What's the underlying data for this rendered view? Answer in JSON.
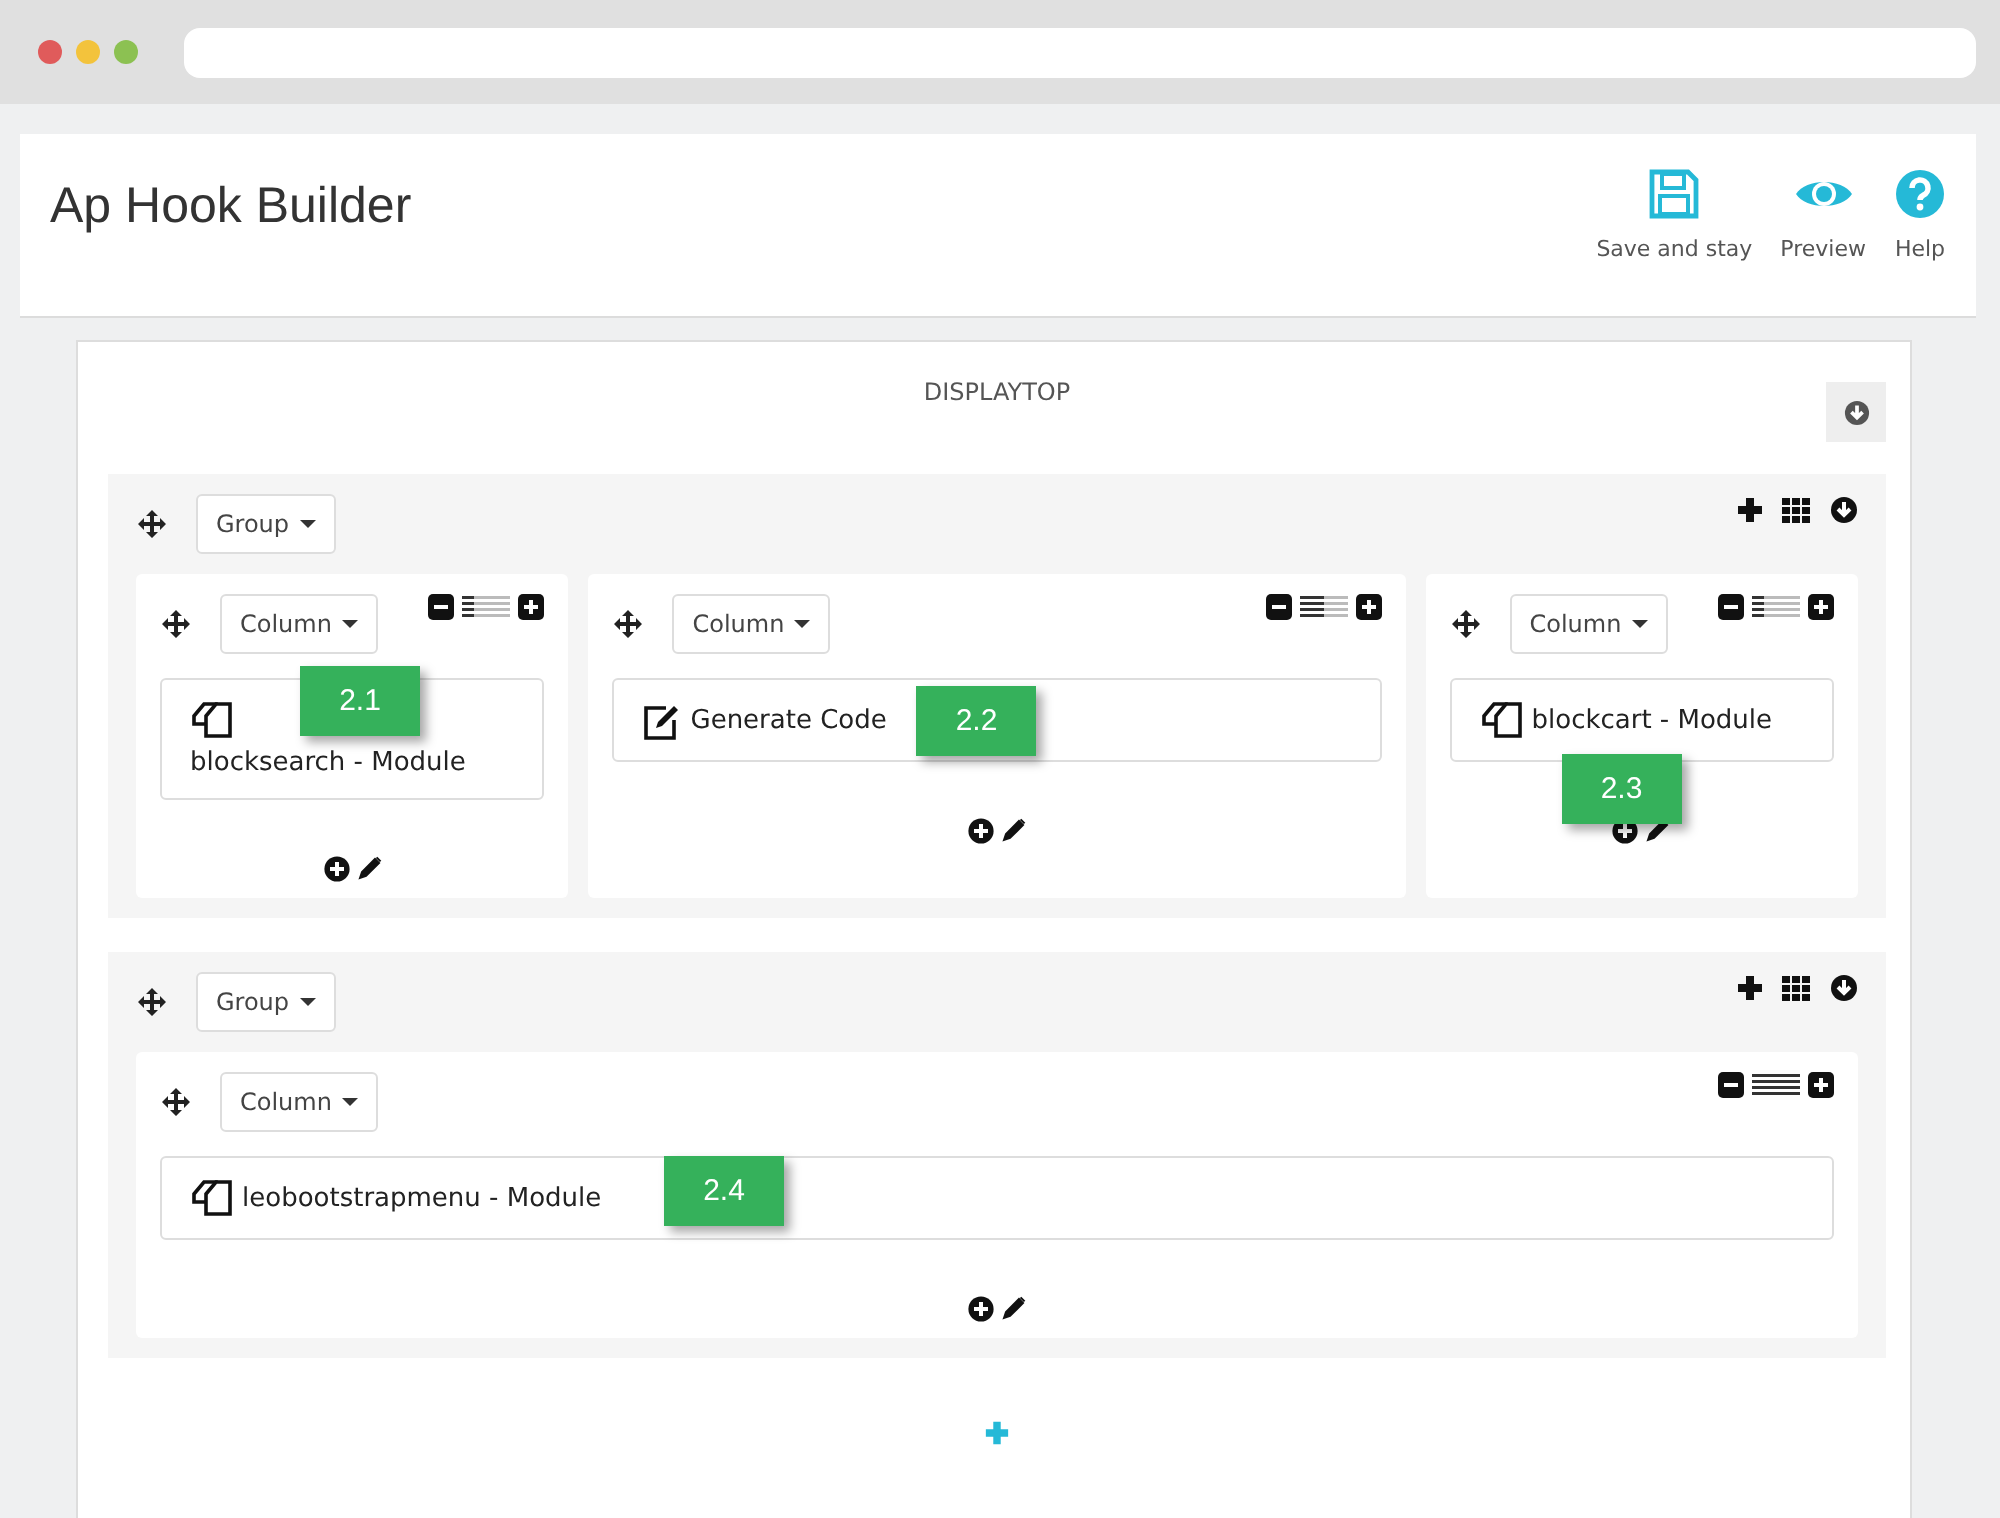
{
  "header": {
    "title": "Ap Hook Builder",
    "actions": [
      {
        "kind": "save",
        "label": "Save and stay"
      },
      {
        "kind": "preview",
        "label": "Preview"
      },
      {
        "kind": "help",
        "label": "Help"
      }
    ]
  },
  "hook": {
    "title": "DISPLAYTOP",
    "groups": [
      {
        "label": "Group",
        "columns": [
          {
            "label": "Column",
            "level": 0.25,
            "items": [
              {
                "kind": "module",
                "text": "blocksearch - Module",
                "badge": "2.1"
              }
            ]
          },
          {
            "label": "Column",
            "level": 0.5,
            "items": [
              {
                "kind": "code",
                "text": "Generate Code",
                "badge": "2.2"
              }
            ]
          },
          {
            "label": "Column",
            "level": 0.25,
            "items": [
              {
                "kind": "module",
                "text": "blockcart - Module",
                "badge": "2.3"
              }
            ]
          }
        ]
      },
      {
        "label": "Group",
        "columns": [
          {
            "label": "Column",
            "level": 1,
            "items": [
              {
                "kind": "module",
                "text": "leobootstrapmenu - Module",
                "badge": "2.4"
              }
            ]
          }
        ]
      }
    ]
  }
}
